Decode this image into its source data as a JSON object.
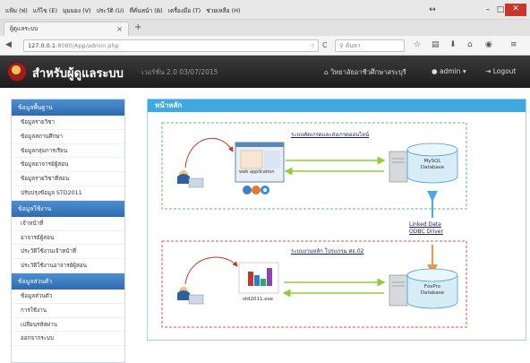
{
  "browser": {
    "menu": [
      "แฟ้ม (ฟ)",
      "แก้ไข (E)",
      "มุมมอง (V)",
      "ประวัติ (U)",
      "ที่คั่นหน้า (B)",
      "เครื่องมือ (T)",
      "ช่วยเหลือ (H)"
    ],
    "tab_title": "ผู้ดูแลระบบ",
    "url_host": "127.0.0.1",
    "url_path": ":8080/App/admin.php",
    "search_placeholder": "ค้นหา"
  },
  "app": {
    "brand": "สำหรับผู้ดูแลระบบ",
    "version": "เวอร์ชั่น 2.0 03/07/2015",
    "college": "วิทยาลัยอาชีวศึกษาสระบุรี",
    "user": "admin",
    "logout": "Logout"
  },
  "sidebar": {
    "sections": [
      {
        "title": "ข้อมูลพื้นฐาน",
        "items": [
          "ข้อมูลรายวิชา",
          "ข้อมูลสถานศึกษา",
          "ข้อมูลกลุ่มการเรียน",
          "ข้อมูลอาจารย์ผู้สอน",
          "ข้อมูลรายวิชาที่สอน",
          "ปรับปรุงข้อมูล STD2011"
        ]
      },
      {
        "title": "ข้อมูลใช้งาน",
        "items": [
          "เจ้าหน้าที่",
          "อาจารย์ผู้สอน",
          "ประวัติใช้งานเจ้าหน้าที่",
          "ประวัติใช้งานอาจารย์ผู้สอน"
        ]
      },
      {
        "title": "ข้อมูลส่วนตัว",
        "items": [
          "ข้อมูลส่วนตัว",
          "การใช้งาน",
          "เปลี่ยนรหัสผ่าน",
          "ออกจากระบบ"
        ]
      }
    ]
  },
  "main": {
    "title": "หน้าหลัก",
    "top_system": "ระบบคัดเกรดและส่งเกรดออนไลน์",
    "web_app": "web application",
    "mysql": [
      "MySQL",
      "Database"
    ],
    "link_line1": "Linked Data",
    "link_line2": "ODBC Driver",
    "bottom_system": "ระบบงานหลัก โปรแกรม ศธ.02",
    "exe": "std2011.exe",
    "foxpro": [
      "FoxPro",
      "Database"
    ]
  },
  "colors": {
    "accent": "#3fa8e0",
    "sidebar_section": "#2e6bb0",
    "arrow": "#e89a4a",
    "green_arrow": "#8fce3a",
    "blue_arrow": "#4aa8e8"
  }
}
